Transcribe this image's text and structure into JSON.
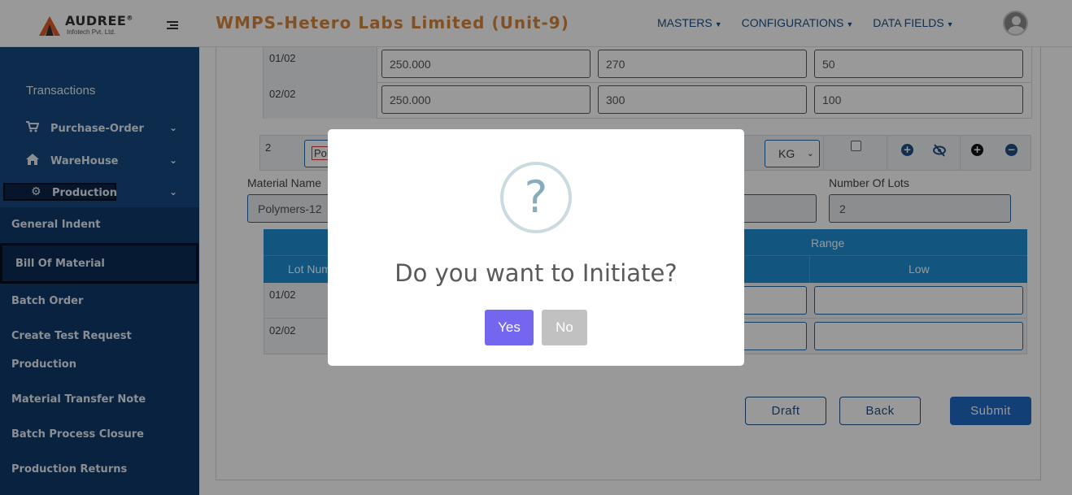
{
  "header": {
    "logo_name": "AUDREE",
    "logo_reg": "®",
    "logo_sub": "Infotech Pvt. Ltd.",
    "app_title": "WMPS-Hetero Labs Limited (Unit-9)",
    "nav": [
      {
        "label": "MASTERS",
        "icon": "chevron-down-icon"
      },
      {
        "label": "CONFIGURATIONS",
        "icon": "chevron-down-icon"
      },
      {
        "label": "DATA FIELDS",
        "icon": "chevron-down-icon"
      }
    ],
    "avatar_icon": "user-avatar-icon"
  },
  "sidebar": {
    "heading": "Transactions",
    "groups": [
      {
        "label": "Purchase-Order",
        "icon": "cart-icon"
      },
      {
        "label": "WareHouse",
        "icon": "home-icon"
      },
      {
        "label": "Production",
        "icon": "gear-icon"
      }
    ],
    "links": [
      "General Indent",
      "Bill Of Material",
      "Batch Order",
      "Create Test Request",
      "Production",
      "Material Transfer Note",
      "Batch Process Closure",
      "Production Returns"
    ]
  },
  "upper_table": {
    "rows": [
      {
        "lot": "01/02",
        "v1": "250.000",
        "v2": "270",
        "v3": "50"
      },
      {
        "lot": "02/02",
        "v1": "250.000",
        "v2": "300",
        "v3": "100"
      }
    ]
  },
  "material_row": {
    "sno": "2",
    "material": "Polym",
    "uom": "KG",
    "icons": [
      "add-circle-outline-icon",
      "eye-slash-icon",
      "add-circle-icon",
      "remove-circle-icon"
    ]
  },
  "fields": {
    "material_name_label": "Material Name",
    "material_name_value": "Polymers-12",
    "lots_label": "Number Of Lots",
    "lots_value": "2"
  },
  "lower_table": {
    "range_header": "Range",
    "lot_header": "Lot Numbe",
    "low_header": "Low",
    "rows": [
      {
        "lot": "01/02"
      },
      {
        "lot": "02/02"
      }
    ]
  },
  "actions": {
    "draft": "Draft",
    "back": "Back",
    "submit": "Submit"
  },
  "dialog": {
    "icon_glyph": "?",
    "title": "Do you want to Initiate?",
    "yes": "Yes",
    "no": "No"
  },
  "colors": {
    "title_orange": "#d8883f",
    "sidebar_blue": "#0f3a6b",
    "table_header": "#1e8fd6",
    "yes_button": "#7367f0"
  }
}
